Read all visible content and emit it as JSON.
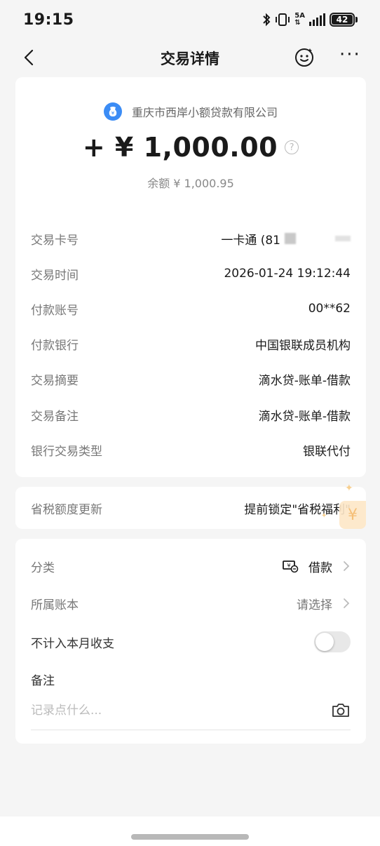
{
  "status": {
    "time": "19:15",
    "network": "5A",
    "battery": "42"
  },
  "nav": {
    "title": "交易详情",
    "more": "···"
  },
  "transaction": {
    "merchant": "重庆市西岸小额贷款有限公司",
    "merchant_logo": "¥",
    "amount": "+ ¥ 1,000.00",
    "balance": "余额 ¥ 1,000.95",
    "details": [
      {
        "label": "交易卡号",
        "value": "一卡通 (81"
      },
      {
        "label": "交易时间",
        "value": "2026-01-24 19:12:44"
      },
      {
        "label": "付款账号",
        "value": "00**62"
      },
      {
        "label": "付款银行",
        "value": "中国银联成员机构"
      },
      {
        "label": "交易摘要",
        "value": "滴水贷-账单-借款"
      },
      {
        "label": "交易备注",
        "value": "滴水贷-账单-借款"
      },
      {
        "label": "银行交易类型",
        "value": "银联代付"
      }
    ]
  },
  "tax": {
    "label": "省税额度更新",
    "value": "提前锁定\"省税福利\"",
    "badge": "¥"
  },
  "extra": {
    "category_label": "分类",
    "category_value": "借款",
    "account_label": "所属账本",
    "account_value": "请选择",
    "exclude_label": "不计入本月收支",
    "exclude_on": false,
    "note_label": "备注",
    "note_placeholder": "记录点什么..."
  },
  "colors": {
    "accent": "#3b8cf5",
    "background": "#f5f5f5",
    "badge": "#fde7c7"
  }
}
